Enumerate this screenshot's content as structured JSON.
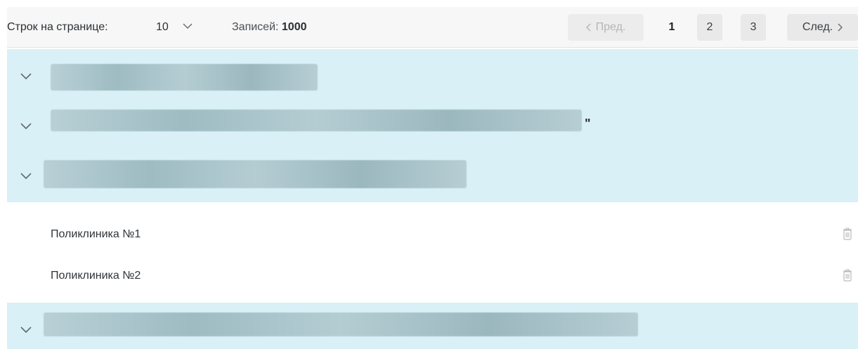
{
  "pagination": {
    "rows_label": "Строк на странице:",
    "rows_value": "10",
    "records_label": "Записей:",
    "records_count": "1000",
    "prev_label": "Пред.",
    "next_label": "След.",
    "pages": [
      "1",
      "2",
      "3"
    ],
    "current_page": "1"
  },
  "group_rows": [
    {
      "name": "[redacted]"
    },
    {
      "name": "[redacted]",
      "suffix": "\""
    },
    {
      "name": "[redacted]"
    },
    {
      "name": "[redacted]"
    }
  ],
  "items": [
    {
      "label": "Поликлиника №1"
    },
    {
      "label": "Поликлиника №2"
    }
  ],
  "colors": {
    "group_background": "#d9f0f6",
    "toolbar_background": "#f7f7f7",
    "page_button": "#e9e9e9"
  },
  "icons": [
    "chevron-down-icon",
    "chevron-left-icon",
    "chevron-right-icon",
    "trash-icon"
  ]
}
